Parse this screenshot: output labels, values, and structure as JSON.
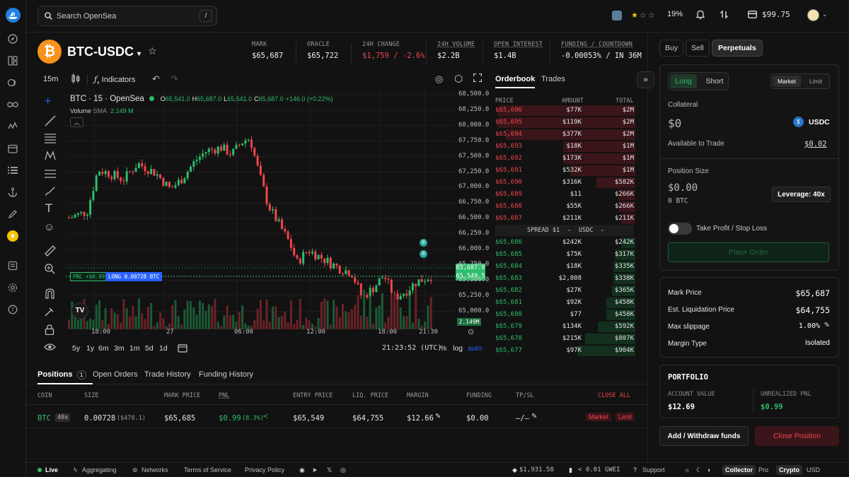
{
  "search": {
    "placeholder": "Search OpenSea",
    "shortcut": "/"
  },
  "topbar": {
    "stars_pct": "19%",
    "balance": "$99.75"
  },
  "market": {
    "pair": "BTC-USDC",
    "stats": [
      {
        "label": "MARK",
        "value": "$65,687",
        "color": "#f0f0f0"
      },
      {
        "label": "ORACLE",
        "value": "$65,722",
        "color": "#f0f0f0"
      },
      {
        "label": "24H CHANGE",
        "value": "$1,759 / -2.6%",
        "color": "#f0454f"
      },
      {
        "label": "24H VOLUME",
        "value": "$2.2B",
        "color": "#f0f0f0"
      },
      {
        "label": "OPEN INTEREST",
        "value": "$1.4B",
        "color": "#f0f0f0"
      },
      {
        "label": "FUNDING / COUNTDOWN",
        "value": "-0.00053% / IN 36M",
        "color": "#f0f0f0"
      }
    ]
  },
  "chart_toolbar": {
    "interval": "15m",
    "indicators": "Indicators"
  },
  "chart_legend": {
    "symbol": "BTC · 15 · OpenSea",
    "o_label": "O",
    "o": "65,541.0",
    "h_label": "H",
    "h": "65,687.0",
    "l_label": "L",
    "l": "65,541.0",
    "c_label": "C",
    "c": "65,687.0",
    "change": "+146.0 (+0.22%)",
    "volume_label": "Volume",
    "sma_label": "SMA",
    "volume_value": "2.149 M"
  },
  "position_line": {
    "pnl": "PNL +$0.99",
    "label": "LONG 0.00728 BTC"
  },
  "price_tags": {
    "mark": "65,687.0",
    "position": "65,549.5",
    "volume": "2.149M"
  },
  "range_buttons": [
    "5y",
    "1y",
    "6m",
    "3m",
    "1m",
    "5d",
    "1d"
  ],
  "chart_footer": {
    "time": "21:23:52 (UTC)",
    "pct": "%",
    "log": "log",
    "auto": "auto"
  },
  "chart_data": {
    "type": "candlestick",
    "interval": "15m",
    "y_ticks": [
      "68,500.0",
      "68,250.0",
      "68,000.0",
      "67,750.0",
      "67,500.0",
      "67,250.0",
      "67,000.0",
      "66,750.0",
      "66,500.0",
      "66,250.0",
      "66,000.0",
      "65,750.0",
      "65,500.0",
      "65,250.0",
      "65,000.0"
    ],
    "x_ticks": [
      "18:00",
      "27",
      "06:00",
      "12:00",
      "18:00",
      "21:30"
    ],
    "ylim": [
      64900,
      68550
    ],
    "series_path": [
      [
        0,
        66600
      ],
      [
        0.05,
        66700
      ],
      [
        0.08,
        67350
      ],
      [
        0.11,
        67300
      ],
      [
        0.15,
        67200
      ],
      [
        0.19,
        67450
      ],
      [
        0.24,
        67300
      ],
      [
        0.28,
        67050
      ],
      [
        0.31,
        67200
      ],
      [
        0.35,
        67500
      ],
      [
        0.38,
        67650
      ],
      [
        0.42,
        67700
      ],
      [
        0.45,
        67600
      ],
      [
        0.48,
        67800
      ],
      [
        0.5,
        67850
      ],
      [
        0.52,
        67400
      ],
      [
        0.55,
        66800
      ],
      [
        0.58,
        66500
      ],
      [
        0.61,
        66200
      ],
      [
        0.63,
        65900
      ],
      [
        0.66,
        66100
      ],
      [
        0.69,
        66000
      ],
      [
        0.72,
        65900
      ],
      [
        0.75,
        65800
      ],
      [
        0.78,
        65750
      ],
      [
        0.81,
        65350
      ],
      [
        0.84,
        65500
      ],
      [
        0.87,
        65700
      ],
      [
        0.9,
        65350
      ],
      [
        0.93,
        65450
      ],
      [
        0.96,
        65600
      ],
      [
        1,
        65687
      ]
    ]
  },
  "orderbook": {
    "tabs": [
      "Orderbook",
      "Trades"
    ],
    "headers": [
      "PRICE",
      "AMOUNT",
      "TOTAL"
    ],
    "asks": [
      {
        "price": "$65,696",
        "amount": "$77K",
        "total": "$2M",
        "depth": 0.95
      },
      {
        "price": "$65,695",
        "amount": "$119K",
        "total": "$2M",
        "depth": 0.95
      },
      {
        "price": "$65,694",
        "amount": "$377K",
        "total": "$2M",
        "depth": 0.9
      },
      {
        "price": "$65,693",
        "amount": "$18K",
        "total": "$1M",
        "depth": 0.5
      },
      {
        "price": "$65,692",
        "amount": "$173K",
        "total": "$1M",
        "depth": 0.5
      },
      {
        "price": "$65,691",
        "amount": "$532K",
        "total": "$1M",
        "depth": 0.45
      },
      {
        "price": "$65,690",
        "amount": "$316K",
        "total": "$582K",
        "depth": 0.27
      },
      {
        "price": "$65,689",
        "amount": "$11",
        "total": "$266K",
        "depth": 0.12
      },
      {
        "price": "$65,688",
        "amount": "$55K",
        "total": "$266K",
        "depth": 0.12
      },
      {
        "price": "$65,687",
        "amount": "$211K",
        "total": "$211K",
        "depth": 0.1
      }
    ],
    "spread": "SPREAD $1",
    "spread_unit": "USDC",
    "bids": [
      {
        "price": "$65,686",
        "amount": "$242K",
        "total": "$242K",
        "depth": 0.1
      },
      {
        "price": "$65,685",
        "amount": "$75K",
        "total": "$317K",
        "depth": 0.14
      },
      {
        "price": "$65,684",
        "amount": "$18K",
        "total": "$335K",
        "depth": 0.15
      },
      {
        "price": "$65,683",
        "amount": "$2,808",
        "total": "$338K",
        "depth": 0.15
      },
      {
        "price": "$65,682",
        "amount": "$27K",
        "total": "$365K",
        "depth": 0.16
      },
      {
        "price": "$65,681",
        "amount": "$92K",
        "total": "$458K",
        "depth": 0.2
      },
      {
        "price": "$65,680",
        "amount": "$77",
        "total": "$458K",
        "depth": 0.2
      },
      {
        "price": "$65,679",
        "amount": "$134K",
        "total": "$592K",
        "depth": 0.26
      },
      {
        "price": "$65,678",
        "amount": "$215K",
        "total": "$807K",
        "depth": 0.35
      },
      {
        "price": "$65,677",
        "amount": "$97K",
        "total": "$904K",
        "depth": 0.4
      }
    ]
  },
  "trade_panel": {
    "top_tabs": [
      "Buy",
      "Sell",
      "Perpetuals"
    ],
    "side_tabs": [
      "Long",
      "Short"
    ],
    "order_types": [
      "Market",
      "Limit"
    ],
    "collateral_label": "Collateral",
    "collateral_value": "$0",
    "collateral_token": "USDC",
    "available_label": "Available to Trade",
    "available_value": "$0.02",
    "position_size_label": "Position Size",
    "position_size_usd": "$0.00",
    "position_size_btc": "0 BTC",
    "leverage": "Leverage: 40x",
    "tpsl_label": "Take Profit / Stop Loss",
    "place_order": "Place Order"
  },
  "summary": [
    {
      "label": "Mark Price",
      "value": "$65,687"
    },
    {
      "label": "Est. Liquidation Price",
      "value": "$64,755"
    },
    {
      "label": "Max slippage",
      "value": "1.00%"
    },
    {
      "label": "Margin Type",
      "value": "Isolated"
    }
  ],
  "portfolio": {
    "title": "PORTFOLIO",
    "account_value_label": "ACCOUNT VALUE",
    "account_value": "$12.69",
    "unrealized_label": "UNREALIZED PNL",
    "unrealized": "$0.99"
  },
  "actions": {
    "add_withdraw": "Add / Withdraw funds",
    "close_position": "Close Position"
  },
  "bottom_tabs": [
    {
      "label": "Positions",
      "count": "1"
    },
    {
      "label": "Open Orders"
    },
    {
      "label": "Trade History"
    },
    {
      "label": "Funding History"
    }
  ],
  "positions": {
    "headers": [
      "COIN",
      "SIZE",
      "MARK PRICE",
      "PNL",
      "ENTRY PRICE",
      "LIQ. PRICE",
      "MARGIN",
      "FUNDING",
      "TP/SL"
    ],
    "close_all": "CLOSE ALL",
    "row": {
      "coin": "BTC",
      "lev": "40x",
      "size": "0.00728",
      "size_usd": "($478.1)",
      "mark": "$65,685",
      "pnl": "$0.99",
      "pnl_pct": "(8.3%)",
      "entry": "$65,549",
      "liq": "$64,755",
      "margin": "$12.66",
      "funding": "$0.00",
      "tpsl": "–/–",
      "market": "Market",
      "limit": "Limit"
    }
  },
  "footer": {
    "live": "Live",
    "aggregating": "Aggregating",
    "networks": "Networks",
    "terms": "Terms of Service",
    "privacy": "Privacy Policy",
    "eth_price": "$1,931.58",
    "gas": "< 0.01 GWEI",
    "support": "Support",
    "collector": "Collector",
    "pro": "Pro",
    "crypto": "Crypto",
    "usd": "USD"
  },
  "colors": {
    "green": "#2ebd6b",
    "red": "#f0454f",
    "accent": "#2081e2"
  }
}
